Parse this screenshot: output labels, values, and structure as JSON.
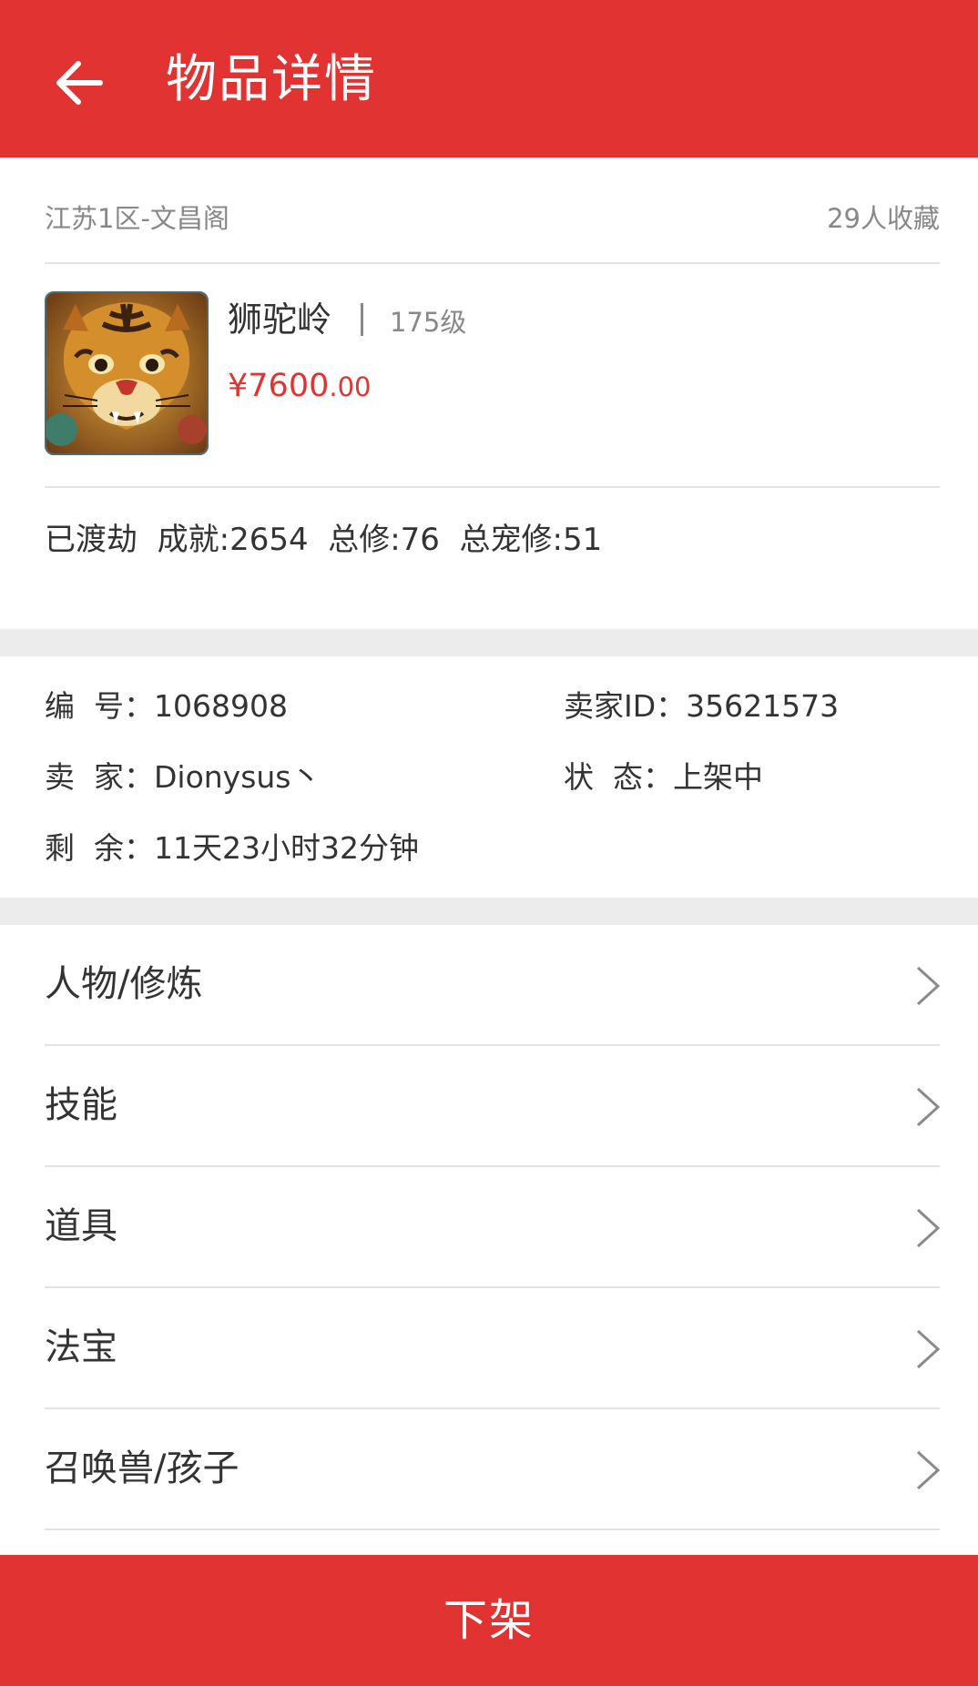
{
  "header": {
    "title": "物品详情",
    "back_icon": "arrow-left-icon"
  },
  "item": {
    "server": "江苏1区-文昌阁",
    "favorites": "29人收藏",
    "name": "狮驼岭",
    "level": "175级",
    "price_currency": "¥",
    "price_integer": "7600",
    "price_decimal": ".00",
    "stats": "已渡劫  成就:2654  总修:76  总宠修:51",
    "avatar_icon": "tiger-avatar-icon"
  },
  "info": {
    "id_label": "编  号：",
    "id_value": "1068908",
    "seller_id_label": "卖家ID：",
    "seller_id_value": "35621573",
    "seller_label": "卖  家：",
    "seller_value": "Dionysus丶",
    "status_label": "状  态：",
    "status_value": "上架中",
    "remaining_label": "剩  余：",
    "remaining_value": "11天23小时32分钟"
  },
  "menu": [
    {
      "label": "人物/修炼",
      "icon": "chevron-right-icon"
    },
    {
      "label": "技能",
      "icon": "chevron-right-icon"
    },
    {
      "label": "道具",
      "icon": "chevron-right-icon"
    },
    {
      "label": "法宝",
      "icon": "chevron-right-icon"
    },
    {
      "label": "召唤兽/孩子",
      "icon": "chevron-right-icon"
    }
  ],
  "bottom_button": {
    "label": "下架"
  },
  "colors": {
    "accent": "#e23333",
    "price": "#e23333",
    "muted": "#888888",
    "divider": "#e3e3e3",
    "gap": "#ececec"
  }
}
